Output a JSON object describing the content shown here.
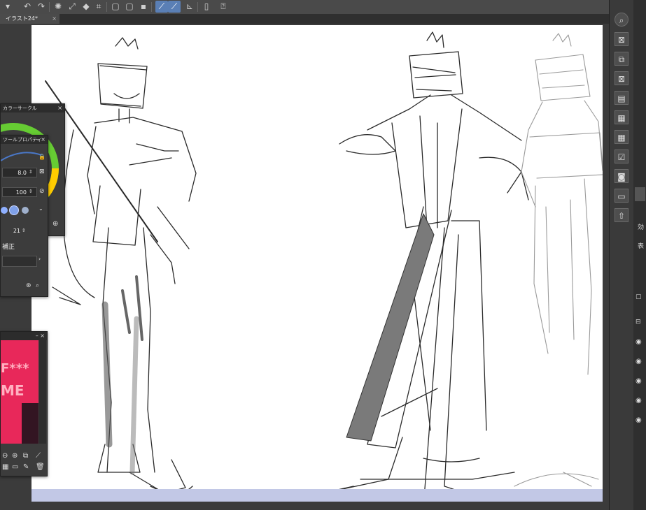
{
  "toolbar": {
    "undo_icon": "undo-icon",
    "redo_icon": "redo-icon",
    "accent": "#5a7fb5"
  },
  "document_tab": {
    "title": "イラスト24*",
    "close": "×"
  },
  "color_circle_panel": {
    "title": "カラーサークル",
    "close": "×"
  },
  "tool_property_panel": {
    "title": "ツールプロパティ",
    "brush_size": "8.0",
    "opacity": "100",
    "stabilization": "21",
    "correction_label": "補正"
  },
  "navigator_panel": {
    "thumb_text_line1": "F***",
    "thumb_text_line2": "ME"
  },
  "right_panel": {
    "label_effect": "効",
    "label_display": "表"
  },
  "colors": {
    "canvas": "#ffffff",
    "background": "#3b3b3b",
    "canvas_bottom_strip": "#c2c8e6"
  }
}
